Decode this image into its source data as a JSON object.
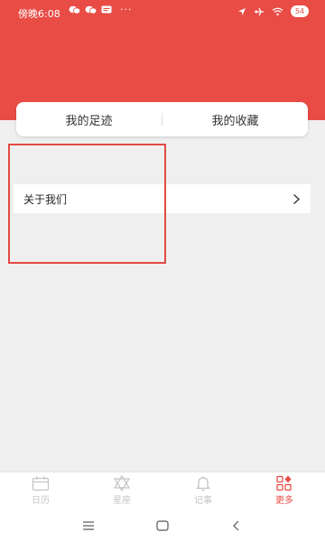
{
  "status_bar": {
    "time": "傍晚6:08",
    "dots": "···",
    "battery": "54"
  },
  "tabs": [
    {
      "label": "我的足迹"
    },
    {
      "label": "我的收藏"
    }
  ],
  "menu": {
    "about_label": "关于我们",
    "chevron": ">"
  },
  "bottom_nav": [
    {
      "label": "日历",
      "icon": "calendar-icon",
      "active": false
    },
    {
      "label": "星座",
      "icon": "star-of-david-icon",
      "active": false
    },
    {
      "label": "记事",
      "icon": "bell-icon",
      "active": false
    },
    {
      "label": "更多",
      "icon": "grid-more-icon",
      "active": true
    }
  ],
  "colors": {
    "accent": "#e84c45",
    "background": "#efefef",
    "highlight_box": "#e24a42"
  }
}
